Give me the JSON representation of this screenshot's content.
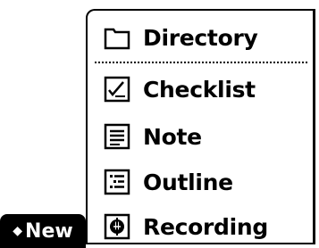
{
  "new_tab": {
    "label": "New",
    "icon": "diamond-icon"
  },
  "menu": {
    "items": [
      {
        "label": "Directory",
        "icon": "folder-icon"
      },
      {
        "label": "Checklist",
        "icon": "checklist-icon"
      },
      {
        "label": "Note",
        "icon": "note-icon"
      },
      {
        "label": "Outline",
        "icon": "outline-icon"
      },
      {
        "label": "Recording",
        "icon": "recording-icon"
      }
    ]
  }
}
